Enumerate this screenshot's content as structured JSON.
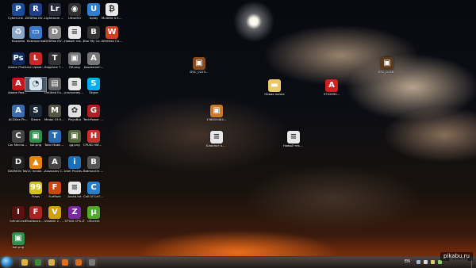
{
  "desktop": {
    "icons": [
      {
        "label": "CyberLink PowerDVD 12",
        "icon": "powerdvd-icon",
        "color": "#1b4c9a",
        "glyph": "P"
      },
      {
        "label": "Корзина",
        "icon": "recycle-bin-icon",
        "color": "#8aa9c9",
        "glyph": "♻"
      },
      {
        "label": "Adobe Photosh...",
        "icon": "photoshop-icon",
        "color": "#0d2a5c",
        "glyph": "Ps"
      },
      {
        "label": "Adobe Reader XI",
        "icon": "adobe-reader-icon",
        "color": "#c7161b",
        "glyph": "A"
      },
      {
        "label": "ACDSee Ph...",
        "icon": "acdsee-icon",
        "color": "#3a6bb0",
        "glyph": "A"
      },
      {
        "label": "Car Mechani...",
        "icon": "car-mechanic-icon",
        "color": "#444444",
        "glyph": "C"
      },
      {
        "label": "DAEMON Tools Ultra",
        "icon": "daemon-tools-icon",
        "color": "#222222",
        "glyph": "D"
      },
      {
        "label": "InfinitCrisis",
        "icon": "infinite-crisis-icon",
        "color": "#5a1010",
        "glyph": "I"
      },
      {
        "label": "kot.png",
        "icon": "image-file-icon",
        "color": "#2f8f4f",
        "glyph": "▣"
      },
      {
        "label": "DVDFab DVD Ripper Ulti...",
        "icon": "dvdfab-icon",
        "color": "#1f3f8a",
        "glyph": "R"
      },
      {
        "label": "Компьютер",
        "icon": "computer-icon",
        "color": "#3a79c8",
        "glyph": "▭"
      },
      {
        "label": "Live Update 5",
        "icon": "live-update-icon",
        "color": "#c8282a",
        "glyph": "L"
      },
      {
        "label": "",
        "icon": "selected-app-icon",
        "color": "#d8e6f2",
        "glyph": "◔"
      },
      {
        "label": "Steam",
        "icon": "steam-icon",
        "color": "#1b2838",
        "glyph": "S"
      },
      {
        "label": "kot.png",
        "icon": "image-file-icon",
        "color": "#2f8f4f",
        "glyph": "▣"
      },
      {
        "label": "VLC media player",
        "icon": "vlc-icon",
        "color": "#e8840c",
        "glyph": "▲"
      },
      {
        "label": "Fraps",
        "icon": "fraps-icon",
        "color": "#d6c21a",
        "glyph": "99"
      },
      {
        "label": "Flashback.exe - Ярлык",
        "icon": "flashback-icon",
        "color": "#aa2222",
        "glyph": "F"
      },
      {
        "label": "Lightroom 5.3 64-bit",
        "icon": "lightroom-icon",
        "color": "#2b2b3b",
        "glyph": "Lr"
      },
      {
        "label": "DVDFab DVD Ultima...",
        "icon": "dvdfab-ultimate-icon",
        "color": "#888888",
        "glyph": "D"
      },
      {
        "label": "Sapphire TRIXX",
        "icon": "sapphire-trixx-icon",
        "color": "#333333",
        "glyph": "T"
      },
      {
        "label": "Untitled Export",
        "icon": "untitled-export-icon",
        "color": "#666666",
        "glyph": "▤"
      },
      {
        "label": "Medal Of Honor Warf...",
        "icon": "medal-of-honor-icon",
        "color": "#555544",
        "glyph": "M"
      },
      {
        "label": "Total Mobile Partner",
        "icon": "mobile-partner-icon",
        "color": "#2a6bb0",
        "glyph": "T"
      },
      {
        "label": "Assassins Creed IV...",
        "icon": "assassins-creed-icon",
        "color": "#444444",
        "glyph": "A"
      },
      {
        "label": "FurMark",
        "icon": "furmark-icon",
        "color": "#c84a10",
        "glyph": "F"
      },
      {
        "label": "ViewNX 2 - Ярлык",
        "icon": "viewnx-icon",
        "color": "#d0a010",
        "glyph": "V"
      },
      {
        "label": "UltraISO",
        "icon": "ultraiso-icon",
        "color": "#303030",
        "glyph": "◉"
      },
      {
        "label": "Новый текстовый...",
        "icon": "text-document-icon",
        "color": "#e8e8e8",
        "glyph": "≡"
      },
      {
        "label": "RR.png",
        "icon": "image-file-icon",
        "color": "#777777",
        "glyph": "▣"
      },
      {
        "label": "ультразвук перинатал",
        "icon": "text-document-icon",
        "color": "#e8e8e8",
        "glyph": "≡"
      },
      {
        "label": "PlaysBro",
        "icon": "playsbro-icon",
        "color": "#e0e0e0",
        "glyph": "✿"
      },
      {
        "label": "gg.png",
        "icon": "image-file-icon",
        "color": "#55663a",
        "glyph": "▣"
      },
      {
        "label": "Intel Processo...",
        "icon": "intel-icon",
        "color": "#1a6fb8",
        "glyph": "i"
      },
      {
        "label": "Asvtb.txt",
        "icon": "text-document-icon",
        "color": "#e8e8e8",
        "glyph": "≡"
      },
      {
        "label": "CPUID CPU-Z",
        "icon": "cpuz-icon",
        "color": "#7a2aa0",
        "glyph": "Z"
      },
      {
        "label": "Uplay",
        "icon": "uplay-icon",
        "color": "#2f7fd0",
        "glyph": "U"
      },
      {
        "label": "Blur My Concert",
        "icon": "blur-icon",
        "color": "#333333",
        "glyph": "B"
      },
      {
        "label": "AssassinsC...",
        "icon": "assassins-creed-icon",
        "color": "#777777",
        "glyph": "A"
      },
      {
        "label": "Skype",
        "icon": "skype-icon",
        "color": "#00aff0",
        "glyph": "S"
      },
      {
        "label": "TechPower GPU-Z",
        "icon": "gpuz-icon",
        "color": "#aa2222",
        "glyph": "G"
      },
      {
        "label": "CPUID HWMonitor",
        "icon": "hwmonitor-icon",
        "color": "#c83030",
        "glyph": "H"
      },
      {
        "label": "BatmanOri... - Ярлык",
        "icon": "batman-icon",
        "color": "#555555",
        "glyph": "B"
      },
      {
        "label": "Call.Of.Cell GAMES",
        "icon": "call-of-cell-icon",
        "color": "#2a80c8",
        "glyph": "C"
      },
      {
        "label": "uTorrent",
        "icon": "utorrent-icon",
        "color": "#4faa2a",
        "glyph": "µ"
      },
      {
        "label": "MultiBit 0.5.17",
        "icon": "multibit-icon",
        "color": "#e8e8e8",
        "glyph": "₿"
      },
      {
        "label": "Wireless Connecti...",
        "icon": "wireless-icon",
        "color": "#d04020",
        "glyph": "W"
      },
      {
        "label": "DSC_0223...",
        "icon": "image-file-icon",
        "color": "#8a4a1a",
        "glyph": "▣"
      },
      {
        "label": "DSC_0136...",
        "icon": "image-file-icon",
        "color": "#5a3a1a",
        "glyph": "▣"
      },
      {
        "label": "Новая папка",
        "icon": "folder-icon",
        "color": "#e8c868",
        "glyph": "▬"
      },
      {
        "label": "5702894...",
        "icon": "pdf-file-icon",
        "color": "#d02020",
        "glyph": "A"
      },
      {
        "label": "1388094848...",
        "icon": "image-file-icon",
        "color": "#c87a2a",
        "glyph": "▣"
      },
      {
        "label": "Блокнот каждое...",
        "icon": "text-document-icon",
        "color": "#e8e8e8",
        "glyph": "≡"
      },
      {
        "label": "Новый текстовый...",
        "icon": "text-document-icon",
        "color": "#e8e8e8",
        "glyph": "≡"
      }
    ]
  },
  "taskbar": {
    "pinned": [
      {
        "name": "explorer-icon",
        "color": "#e0b040"
      },
      {
        "name": "chrome-icon",
        "color": "#3a8a3a"
      },
      {
        "name": "folder-icon",
        "color": "#d8b050"
      },
      {
        "name": "media-player-icon",
        "color": "#e07020"
      },
      {
        "name": "firefox-icon",
        "color": "#d86a1a"
      },
      {
        "name": "app-icon",
        "color": "#7a7a7a"
      }
    ],
    "language": "EN",
    "tray_icons": [
      {
        "name": "network-icon",
        "color": "#9ab8d8"
      },
      {
        "name": "volume-icon",
        "color": "#d8d8d8"
      },
      {
        "name": "flag-icon",
        "color": "#e0d060"
      },
      {
        "name": "battery-icon",
        "color": "#8ad070"
      }
    ],
    "clock_time": "",
    "clock_date": "06.03.2014"
  },
  "watermark": "pikabu.ru"
}
